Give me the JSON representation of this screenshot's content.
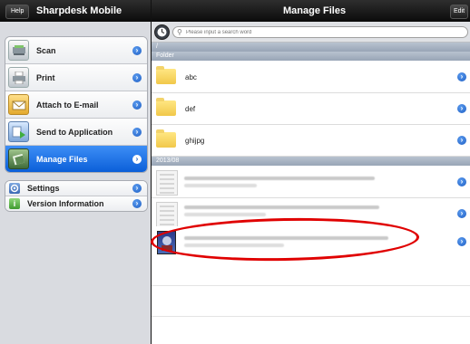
{
  "header": {
    "help_label": "Help",
    "app_title": "Sharpdesk Mobile",
    "page_title": "Manage Files",
    "edit_label": "Edit"
  },
  "sidebar": {
    "items": [
      {
        "label": "Scan",
        "icon": "scanner-icon"
      },
      {
        "label": "Print",
        "icon": "printer-icon"
      },
      {
        "label": "Attach to E-mail",
        "icon": "envelope-icon"
      },
      {
        "label": "Send to Application",
        "icon": "send-to-app-icon"
      },
      {
        "label": "Manage Files",
        "icon": "manage-files-icon",
        "active": true
      }
    ],
    "secondary_items": [
      {
        "label": "Settings",
        "icon": "gear-icon"
      },
      {
        "label": "Version Information",
        "icon": "info-icon"
      }
    ]
  },
  "search": {
    "placeholder": "Please input a search word"
  },
  "path": "/",
  "folder_section": {
    "title": "Folder",
    "folders": [
      {
        "name": "abc"
      },
      {
        "name": "def"
      },
      {
        "name": "ghijpg"
      }
    ]
  },
  "date_section": {
    "title": "2013/08",
    "files": [
      {
        "thumbnail": "document"
      },
      {
        "thumbnail": "document"
      },
      {
        "thumbnail": "photo",
        "highlighted": true
      }
    ]
  },
  "colors": {
    "accent": "#1d63d6",
    "annotation": "#e00000",
    "section_bar": "#a8b4c4"
  }
}
